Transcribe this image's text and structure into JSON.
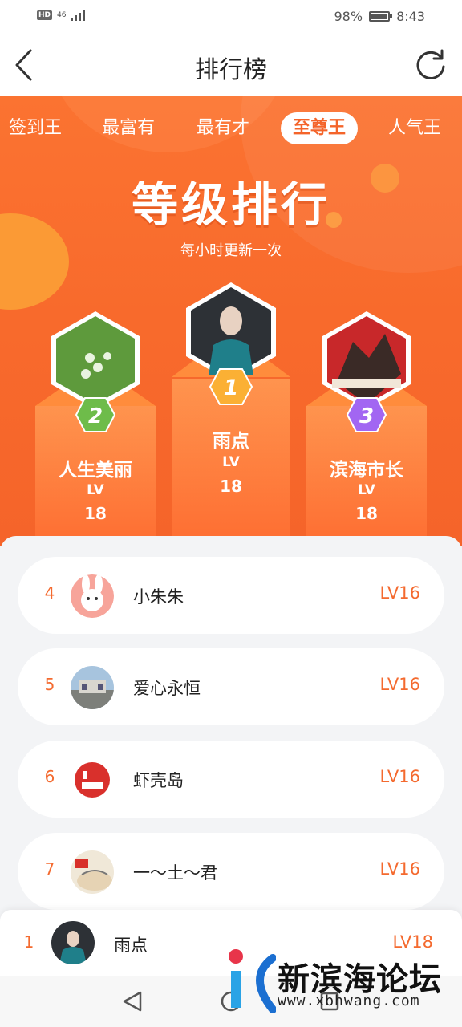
{
  "status_bar": {
    "hd": "HD",
    "network": "46",
    "battery": "98%",
    "battery_level": 0.98,
    "time": "8:43"
  },
  "header": {
    "title": "排行榜"
  },
  "tabs": [
    {
      "label": "签到王",
      "active": false
    },
    {
      "label": "最富有",
      "active": false
    },
    {
      "label": "最有才",
      "active": false
    },
    {
      "label": "至尊王",
      "active": true
    },
    {
      "label": "人气王",
      "active": false
    }
  ],
  "hero": {
    "title": "等级排行",
    "subtitle": "每小时更新一次"
  },
  "podium": {
    "first": {
      "rank": "1",
      "name": "雨点",
      "lv_label": "LV",
      "level": "18"
    },
    "second": {
      "rank": "2",
      "name": "人生美丽",
      "lv_label": "LV",
      "level": "18"
    },
    "third": {
      "rank": "3",
      "name": "滨海市长",
      "lv_label": "LV",
      "level": "18"
    }
  },
  "list": [
    {
      "rank": "4",
      "name": "小朱朱",
      "level": "LV16"
    },
    {
      "rank": "5",
      "name": "爱心永恒",
      "level": "LV16"
    },
    {
      "rank": "6",
      "name": "虾壳岛",
      "level": "LV16"
    },
    {
      "rank": "7",
      "name": "一～土～君",
      "level": "LV16"
    }
  ],
  "my_rank": {
    "rank": "1",
    "name": "雨点",
    "level": "LV18"
  },
  "watermark": {
    "name": "新滨海论坛",
    "url": "www.xbhwang.com"
  },
  "colors": {
    "accent": "#f4642a",
    "hero": "#fb7331"
  }
}
